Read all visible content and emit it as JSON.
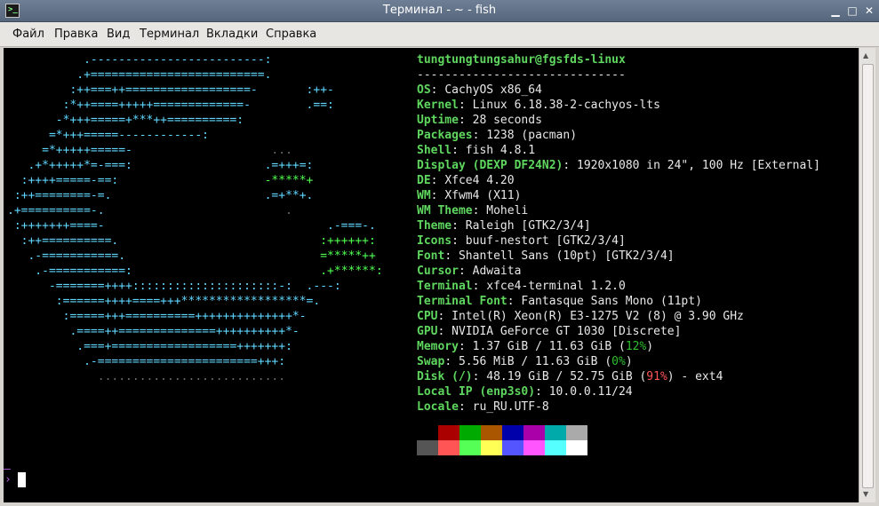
{
  "window": {
    "title": "Терминал - ~ - fish",
    "app_icon": "terminal-icon",
    "app_icon_glyph": ">_",
    "buttons": {
      "minimize": "▁",
      "maximize": "□",
      "close": "✕"
    }
  },
  "menu": [
    "Файл",
    "Правка",
    "Вид",
    "Терминал",
    "Вкладки",
    "Справка"
  ],
  "logo_lines": [
    [
      {
        "c": "b",
        "t": "           .-------------------------:"
      }
    ],
    [
      {
        "c": "b",
        "t": "          .+=========================."
      }
    ],
    [
      {
        "c": "b",
        "t": "         :++===++==================-       :++-"
      }
    ],
    [
      {
        "c": "b",
        "t": "        :*++====+++++=============-        .==:"
      }
    ],
    [
      {
        "c": "b",
        "t": "       -*+++=====+***++==========:"
      }
    ],
    [
      {
        "c": "b",
        "t": "      =*+++=====------------:"
      }
    ],
    [
      {
        "c": "b",
        "t": "     =*+++++=====-"
      },
      {
        "c": "d",
        "t": "                    ..."
      }
    ],
    [
      {
        "c": "b",
        "t": "   .+*+++++*=-===:"
      },
      {
        "c": "b",
        "t": "                   .=+++=:"
      }
    ],
    [
      {
        "c": "b",
        "t": "  :++++=====-==:"
      },
      {
        "c": "g",
        "t": "                     -*****+"
      }
    ],
    [
      {
        "c": "b",
        "t": " :++========-=."
      },
      {
        "c": "b",
        "t": "                      .=+**+."
      }
    ],
    [
      {
        "c": "b",
        "t": ".+==========-."
      },
      {
        "c": "d",
        "t": "                          ."
      }
    ],
    [
      {
        "c": "b",
        "t": " :+++++++====-"
      },
      {
        "c": "b",
        "t": "                                .-===-."
      }
    ],
    [
      {
        "c": "b",
        "t": "  :++==========."
      },
      {
        "c": "g",
        "t": "                             :++++++:"
      }
    ],
    [
      {
        "c": "b",
        "t": "   .-===========."
      },
      {
        "c": "g",
        "t": "                            =*****++"
      }
    ],
    [
      {
        "c": "b",
        "t": "    .-===========:"
      },
      {
        "c": "g",
        "t": "                           .+******:"
      }
    ],
    [
      {
        "c": "b",
        "t": "      -=======++++:::::::::::::::::::::-:  .---:"
      }
    ],
    [
      {
        "c": "b",
        "t": "       :======++++====+++******************=."
      }
    ],
    [
      {
        "c": "b",
        "t": "        :=====+++==========++++++++++++++*-"
      }
    ],
    [
      {
        "c": "b",
        "t": "         .====++==============++++++++++*-"
      }
    ],
    [
      {
        "c": "b",
        "t": "          .===+==================+++++++:"
      }
    ],
    [
      {
        "c": "b",
        "t": "           .-=======================+++:"
      }
    ],
    [
      {
        "c": "d",
        "t": "             ..........................."
      }
    ]
  ],
  "header": {
    "user_host": "tungtungtungsahur@fgsfds-linux",
    "separator": "------------------------------"
  },
  "info": [
    {
      "key": "OS",
      "value": "CachyOS x86_64"
    },
    {
      "key": "Kernel",
      "value": "Linux 6.18.38-2-cachyos-lts"
    },
    {
      "key": "Uptime",
      "value": "28 seconds"
    },
    {
      "key": "Packages",
      "value": "1238 (pacman)"
    },
    {
      "key": "Shell",
      "value": "fish 4.8.1"
    },
    {
      "key": "Display (DEXP DF24N2)",
      "value": "1920x1080 in 24\", 100 Hz [External]"
    },
    {
      "key": "DE",
      "value": "Xfce4 4.20"
    },
    {
      "key": "WM",
      "value": "Xfwm4 (X11)"
    },
    {
      "key": "WM Theme",
      "value": "Moheli"
    },
    {
      "key": "Theme",
      "value": "Raleigh [GTK2/3/4]"
    },
    {
      "key": "Icons",
      "value": "buuf-nestort [GTK2/3/4]"
    },
    {
      "key": "Font",
      "value": "Shantell Sans (10pt) [GTK2/3/4]"
    },
    {
      "key": "Cursor",
      "value": "Adwaita"
    },
    {
      "key": "Terminal",
      "value": "xfce4-terminal 1.2.0"
    },
    {
      "key": "Terminal Font",
      "value": "Fantasque Sans Mono (11pt)"
    },
    {
      "key": "CPU",
      "value": "Intel(R) Xeon(R) E3-1275 V2 (8) @ 3.90 GHz"
    },
    {
      "key": "GPU",
      "value": "NVIDIA GeForce GT 1030 [Discrete]"
    },
    {
      "key": "Memory",
      "value": "1.37 GiB / 11.63 GiB (",
      "pct": "12%",
      "pct_color": "green",
      "tail": ")"
    },
    {
      "key": "Swap",
      "value": "5.56 MiB / 11.63 GiB (",
      "pct": "0%",
      "pct_color": "green",
      "tail": ")"
    },
    {
      "key": "Disk (/)",
      "value": "48.19 GiB / 52.75 GiB (",
      "pct": "91%",
      "pct_color": "red",
      "tail": ") - ext4"
    },
    {
      "key": "Local IP (enp3s0)",
      "value": "10.0.0.11/24"
    },
    {
      "key": "Locale",
      "value": "ru_RU.UTF-8"
    }
  ],
  "palette": {
    "normal": [
      "#000000",
      "#aa0000",
      "#00aa00",
      "#aa5500",
      "#0000aa",
      "#aa00aa",
      "#00aaaa",
      "#aaaaaa"
    ],
    "bright": [
      "#555555",
      "#ff5555",
      "#55ff55",
      "#ffff55",
      "#5555ff",
      "#ff55ff",
      "#55ffff",
      "#ffffff"
    ]
  },
  "prompt": {
    "line": "–",
    "char": "›"
  }
}
